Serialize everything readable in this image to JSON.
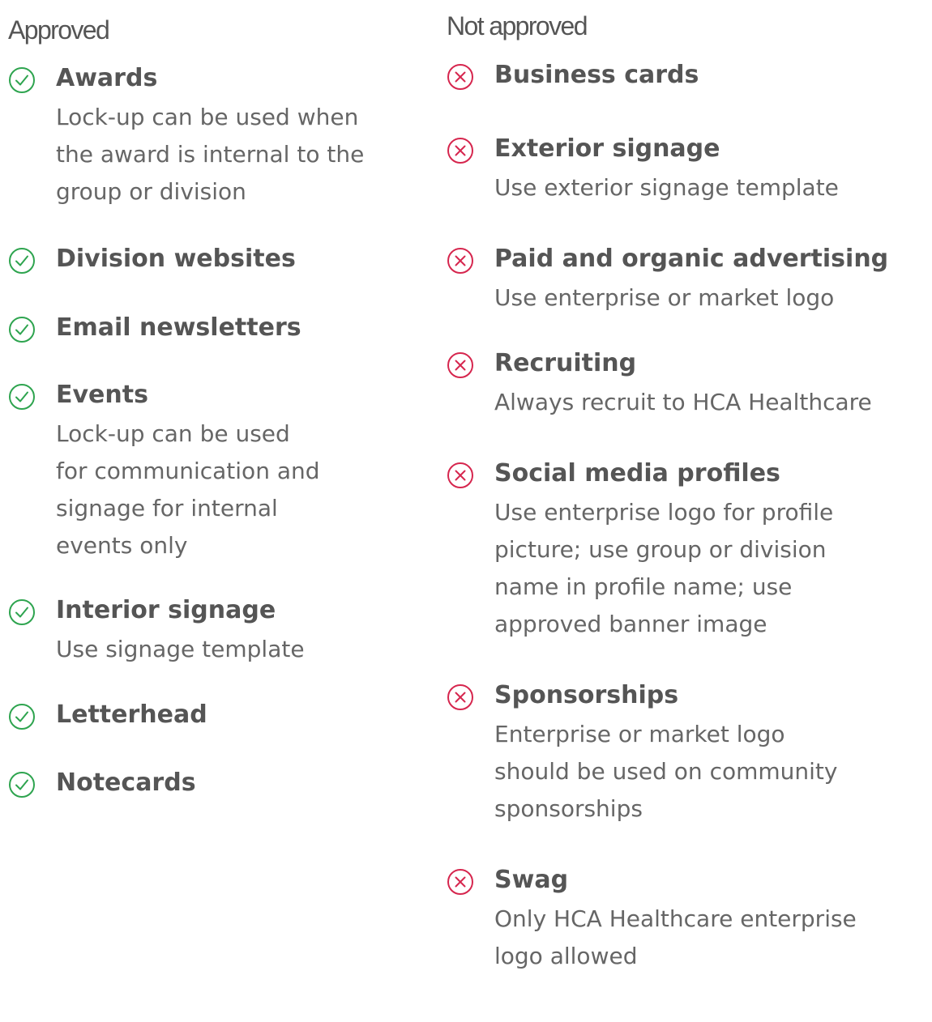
{
  "colors": {
    "approved_icon": "#2ea44f",
    "not_approved_icon": "#d6264e",
    "text": "#555555"
  },
  "approved": {
    "heading": "Approved",
    "icon": "check-circle-icon",
    "items": [
      {
        "title": "Awards",
        "description": "Lock-up can be used when\nthe award is internal to the\ngroup or division"
      },
      {
        "title": "Division websites",
        "description": ""
      },
      {
        "title": "Email newsletters",
        "description": ""
      },
      {
        "title": "Events",
        "description": "Lock-up can be used\nfor communication and\nsignage for internal\nevents only"
      },
      {
        "title": "Interior signage",
        "description": "Use signage template"
      },
      {
        "title": "Letterhead",
        "description": ""
      },
      {
        "title": "Notecards",
        "description": ""
      }
    ]
  },
  "not_approved": {
    "heading": "Not approved",
    "icon": "x-circle-icon",
    "items": [
      {
        "title": "Business cards",
        "description": ""
      },
      {
        "title": "Exterior signage",
        "description": "Use exterior signage template"
      },
      {
        "title": "Paid and organic advertising",
        "description": "Use enterprise or market logo"
      },
      {
        "title": "Recruiting",
        "description": "Always recruit to HCA Healthcare"
      },
      {
        "title": "Social media profiles",
        "description": "Use enterprise logo for profile\npicture; use group or division\nname in profile name; use\napproved banner image"
      },
      {
        "title": "Sponsorships",
        "description": "Enterprise or market logo\nshould be used on community\nsponsorships"
      },
      {
        "title": "Swag",
        "description": "Only HCA Healthcare enterprise\nlogo allowed"
      }
    ]
  }
}
